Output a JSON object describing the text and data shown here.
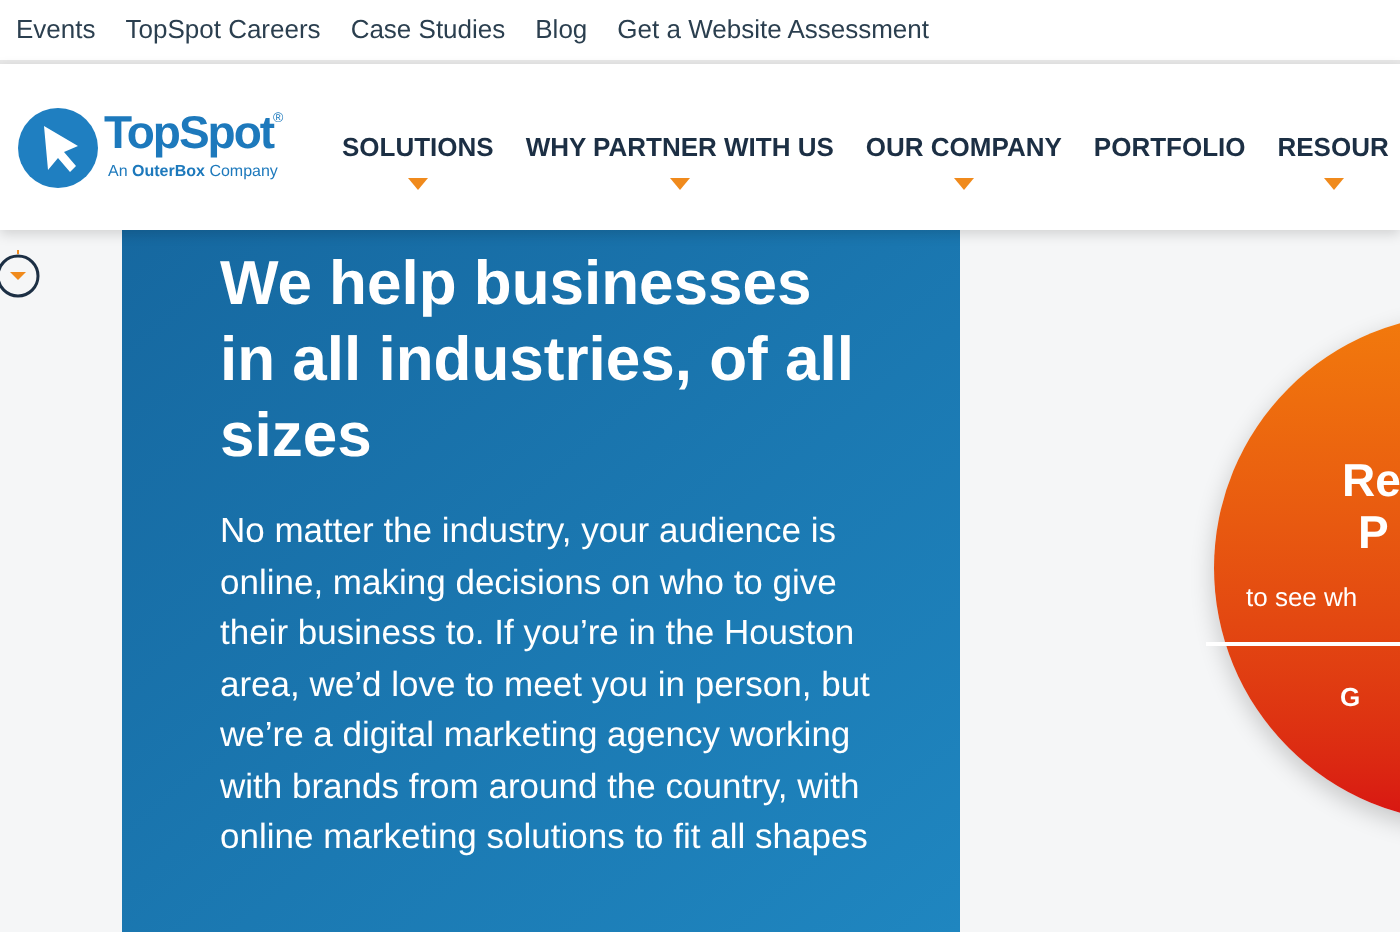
{
  "top_links": [
    "Events",
    "TopSpot Careers",
    "Case Studies",
    "Blog",
    "Get a Website Assessment"
  ],
  "logo": {
    "name": "TopSpot",
    "mark": "®",
    "tagline": "An **OuterBox** Company"
  },
  "nav": [
    {
      "label": "SOLUTIONS",
      "has_dropdown": true
    },
    {
      "label": "WHY PARTNER WITH US",
      "has_dropdown": true
    },
    {
      "label": "OUR COMPANY",
      "has_dropdown": true
    },
    {
      "label": "PORTFOLIO",
      "has_dropdown": false
    },
    {
      "label": "RESOUR",
      "has_dropdown": true
    }
  ],
  "hero": {
    "heading": "We help businesses in all industries, of all sizes",
    "body": "No matter the industry, your audience is online, making decisions on who to give their business to. If you’re in the Houston area, we’d love to meet you in person, but we’re a digital marketing agency working with brands from around the country, with online marketing solutions to fit all shapes"
  },
  "promo": {
    "title_lines": [
      "Re",
      "P"
    ],
    "subtitle": "to see wh",
    "cta": "G"
  }
}
